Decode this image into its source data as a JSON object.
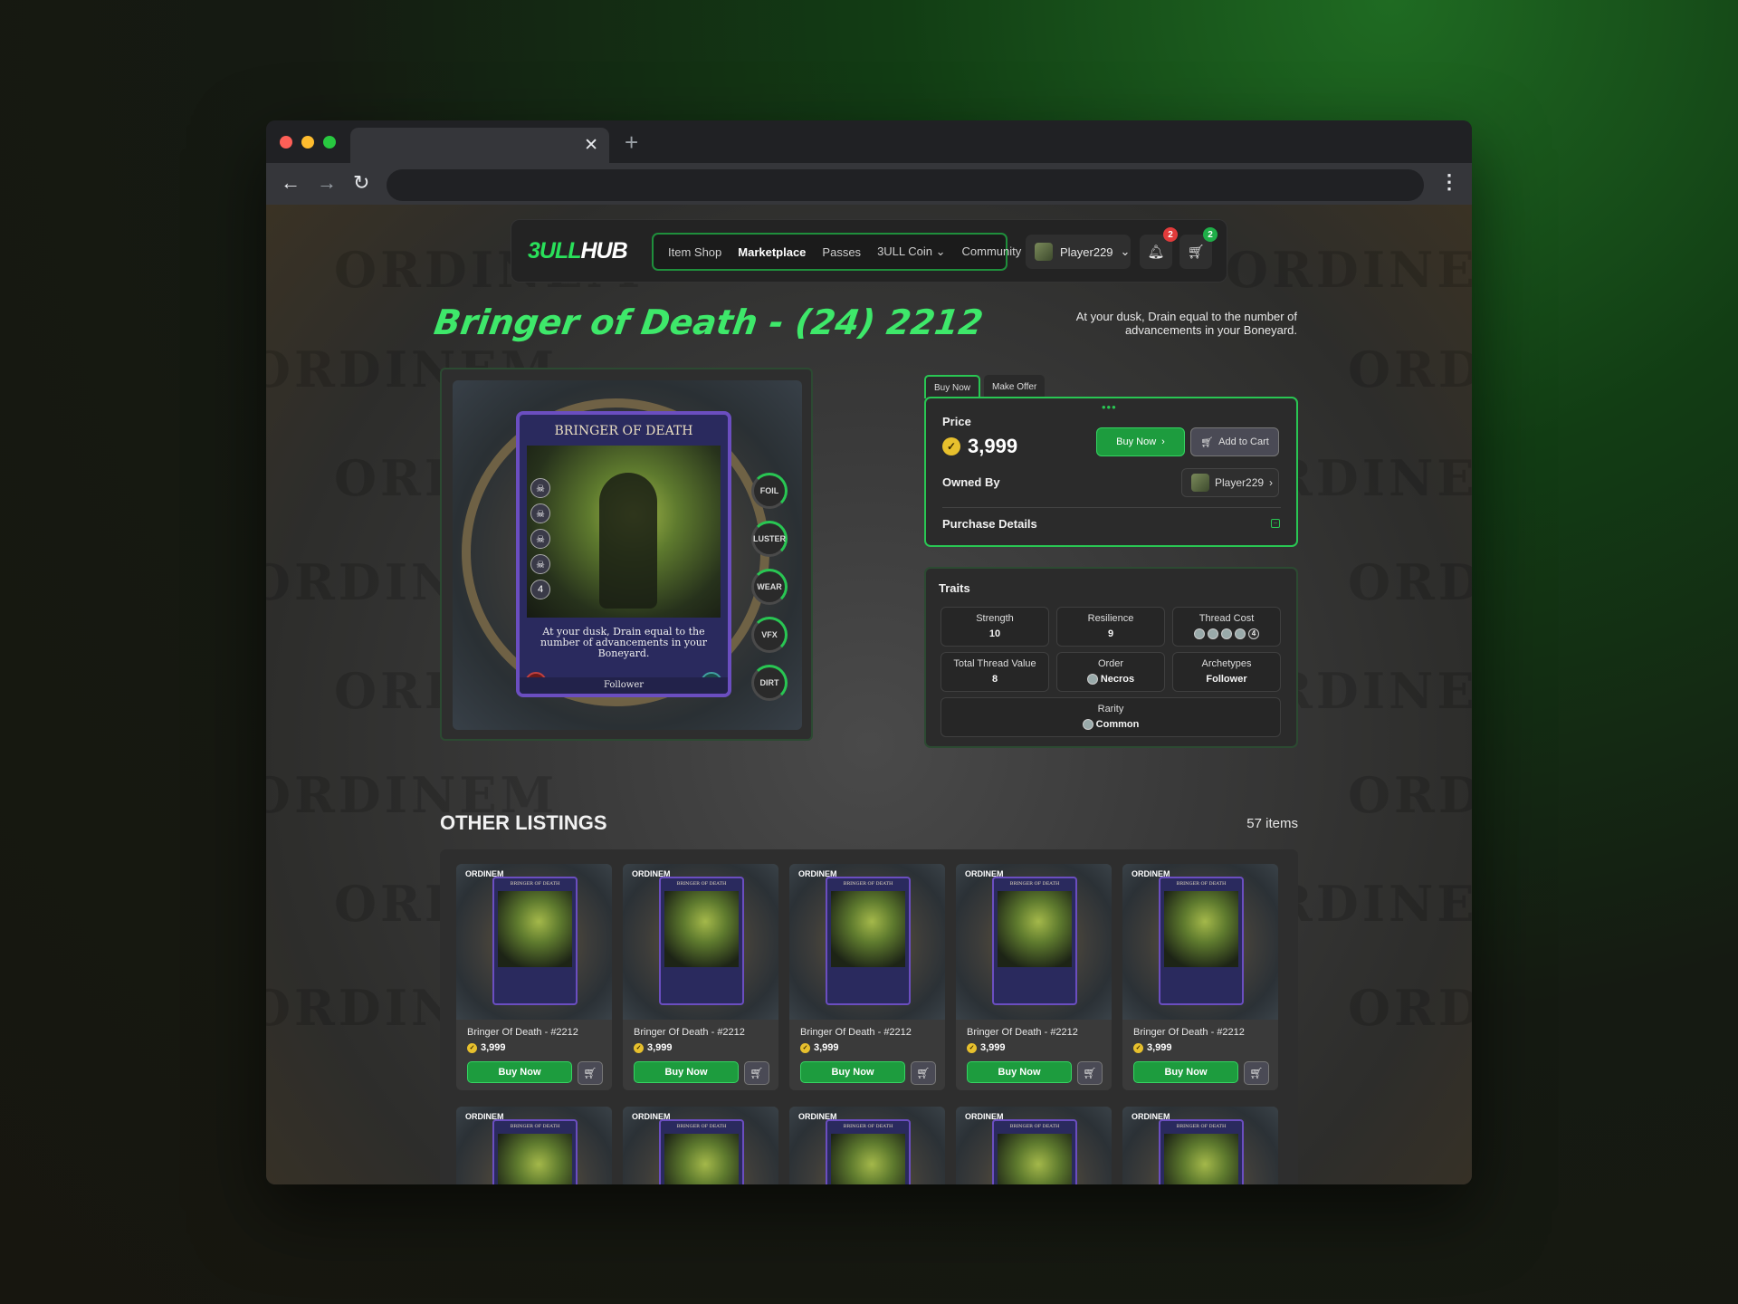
{
  "browser": {
    "new_tab": "+",
    "close_tab": "✕"
  },
  "header": {
    "logo_a": "3ULL",
    "logo_b": "HUB",
    "menu": [
      "Item Shop",
      "Marketplace",
      "Passes",
      "3ULL Coin ⌄",
      "Community ⌄"
    ],
    "username": "Player229",
    "notif_count": "2",
    "cart_count": "2"
  },
  "product": {
    "title": "Bringer of Death - (24) 2212",
    "description": "At your dusk, Drain equal to the number of advancements in your Boneyard."
  },
  "card": {
    "name": "BRINGER OF DEATH",
    "thread_cost": "4",
    "text": "At your dusk, Drain equal to the number of advancements in your Boneyard.",
    "strength": "10",
    "resilience": "9",
    "type": "Follower",
    "dials": [
      "FOIL",
      "LUSTER",
      "WEAR",
      "VFX",
      "DIRT"
    ]
  },
  "buy": {
    "tabs": [
      "Buy Now",
      "Make Offer"
    ],
    "price_label": "Price",
    "price": "3,999",
    "buy_now": "Buy Now",
    "add_to_cart": "Add to Cart",
    "owned_by_label": "Owned By",
    "owner": "Player229",
    "purchase_details": "Purchase Details"
  },
  "traits": {
    "heading": "Traits",
    "strength": {
      "label": "Strength",
      "value": "10"
    },
    "resilience": {
      "label": "Resilience",
      "value": "9"
    },
    "thread_cost": {
      "label": "Thread Cost",
      "value": "4"
    },
    "total_thread_value": {
      "label": "Total Thread Value",
      "value": "8"
    },
    "order": {
      "label": "Order",
      "value": "Necros"
    },
    "archetypes": {
      "label": "Archetypes",
      "value": "Follower"
    },
    "rarity": {
      "label": "Rarity",
      "value": "Common"
    }
  },
  "listings": {
    "title": "OTHER LISTINGS",
    "count": "57 items",
    "brand": "ORDINEM",
    "mini_card_name": "BRINGER OF DEATH",
    "item_name": "Bringer Of Death - #2212",
    "item_price": "3,999",
    "buy_label": "Buy Now"
  },
  "watermark": "ORDINEM"
}
